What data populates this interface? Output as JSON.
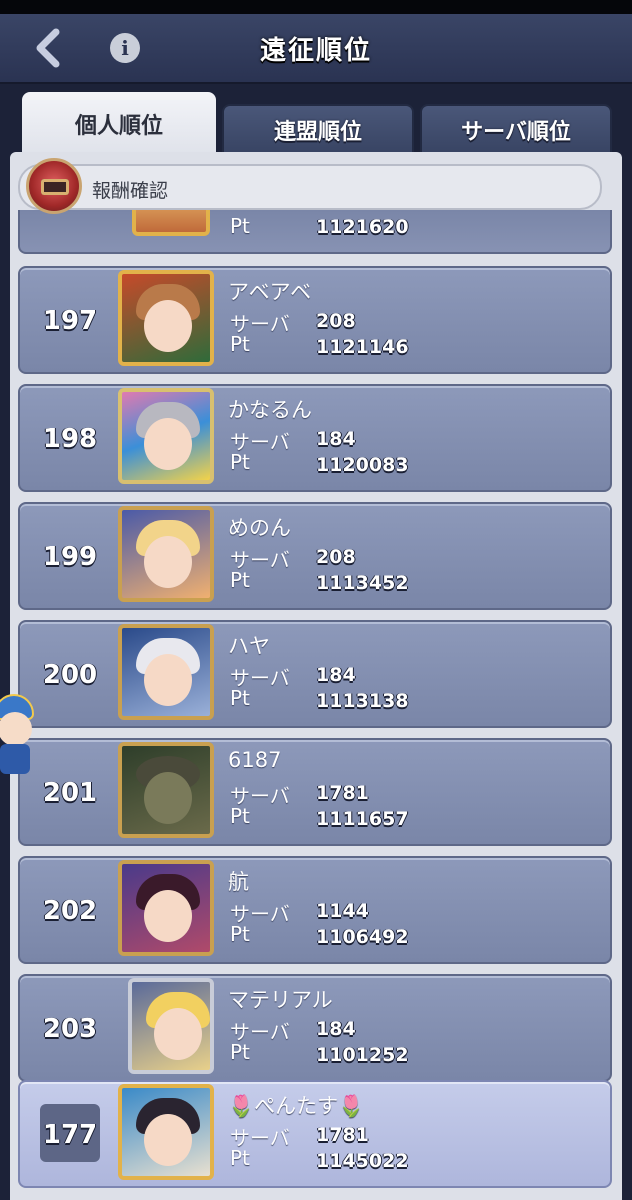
{
  "header": {
    "title": "遠征順位",
    "back_icon": "back-arrow-icon",
    "info_icon": "info-icon",
    "info_glyph": "i"
  },
  "tabs": [
    {
      "label": "個人順位",
      "active": true
    },
    {
      "label": "連盟順位",
      "active": false
    },
    {
      "label": "サーバ順位",
      "active": false
    }
  ],
  "reward": {
    "label": "報酬確認",
    "icon": "treasure-chest-icon"
  },
  "labels": {
    "server": "サーバ",
    "pt": "Pt"
  },
  "partial_row": {
    "pt": "1121620"
  },
  "rows": [
    {
      "rank": "197",
      "name": "アベアベ",
      "server": "208",
      "pt": "1121146"
    },
    {
      "rank": "198",
      "name": "かなるん",
      "server": "184",
      "pt": "1120083"
    },
    {
      "rank": "199",
      "name": "めのん",
      "server": "208",
      "pt": "1113452"
    },
    {
      "rank": "200",
      "name": "ハヤ",
      "server": "184",
      "pt": "1113138"
    },
    {
      "rank": "201",
      "name": "6187",
      "server": "1781",
      "pt": "1111657"
    },
    {
      "rank": "202",
      "name": "航",
      "server": "1144",
      "pt": "1106492"
    },
    {
      "rank": "203",
      "name": "マテリアル",
      "server": "184",
      "pt": "1101252"
    }
  ],
  "my_row": {
    "rank": "177",
    "name": "🌷ぺんたす🌷",
    "server": "1781",
    "pt": "1145022"
  },
  "colors": {
    "row_bg": "#8592b4",
    "my_row_bg": "#b9c1e3",
    "panel_bg": "#dde0e8",
    "header_bg": "#323d5e"
  }
}
